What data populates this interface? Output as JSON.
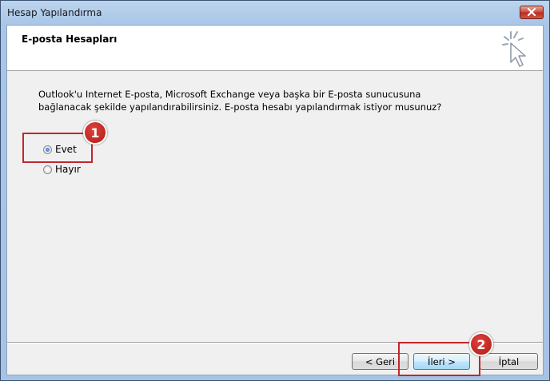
{
  "window": {
    "title": "Hesap Yapılandırma"
  },
  "header": {
    "title": "E-posta Hesapları",
    "icon": "cursor-sparkle-icon"
  },
  "body": {
    "description_line1": "Outlook'u Internet E-posta, Microsoft Exchange veya başka bir E-posta sunucusuna",
    "description_line2": "bağlanacak şekilde yapılandırabilirsiniz. E-posta hesabı yapılandırmak istiyor musunuz?"
  },
  "options": [
    {
      "label": "Evet",
      "selected": true
    },
    {
      "label": "Hayır",
      "selected": false
    }
  ],
  "annotations": {
    "step1": "1",
    "step2": "2",
    "color": "#c0272d"
  },
  "buttons": {
    "back": "< Geri",
    "next": "İleri >",
    "cancel": "İptal"
  }
}
